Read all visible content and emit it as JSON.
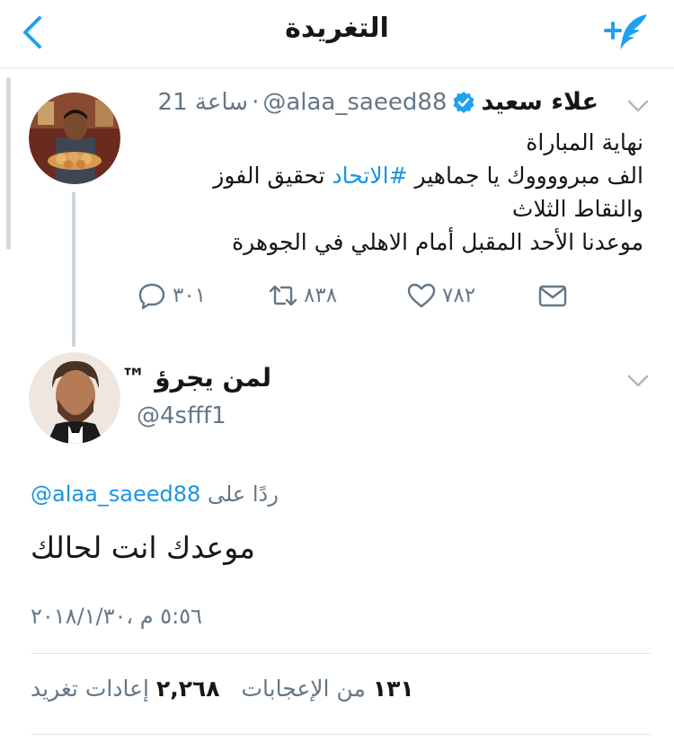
{
  "nav": {
    "title": "التغريدة",
    "back_icon": "chevron-left-icon",
    "compose_icon": "compose-tweet-icon",
    "accent": "#1da1f2"
  },
  "parent_tweet": {
    "time": "21 ساعة",
    "separator": "·",
    "handle": "@alaa_saeed88",
    "name": "علاء سعيد",
    "verified": true,
    "lines": [
      "نهاية المباراة",
      "الف مبرووووك يا جماهير",
      "#الاتحاد",
      "تحقيق الفوز والنقاط الثلاث",
      "موعدنا الأحد المقبل أمام الاهلي في الجوهرة"
    ],
    "replies": "٣٠١",
    "retweets": "٨٣٨",
    "likes": "٧٨٢"
  },
  "reply_tweet": {
    "name": "لمن يجرؤ ™",
    "handle": "@4sfff1",
    "reply_label": "ردًا على",
    "reply_to": "@alaa_saeed88",
    "text": "موعدك انت لحالك",
    "timestamp": "٥:٥٦ م ،٢٠١٨/١/٣٠",
    "likes_count": "١٣١",
    "likes_label": "من الإعجابات",
    "retweets_count": "٢,٢٦٨",
    "retweets_label": "إعادات تغريد"
  },
  "colors": {
    "link": "#1b95e0",
    "muted": "#657786",
    "text": "#14171a",
    "divider": "#e1e8ed"
  }
}
